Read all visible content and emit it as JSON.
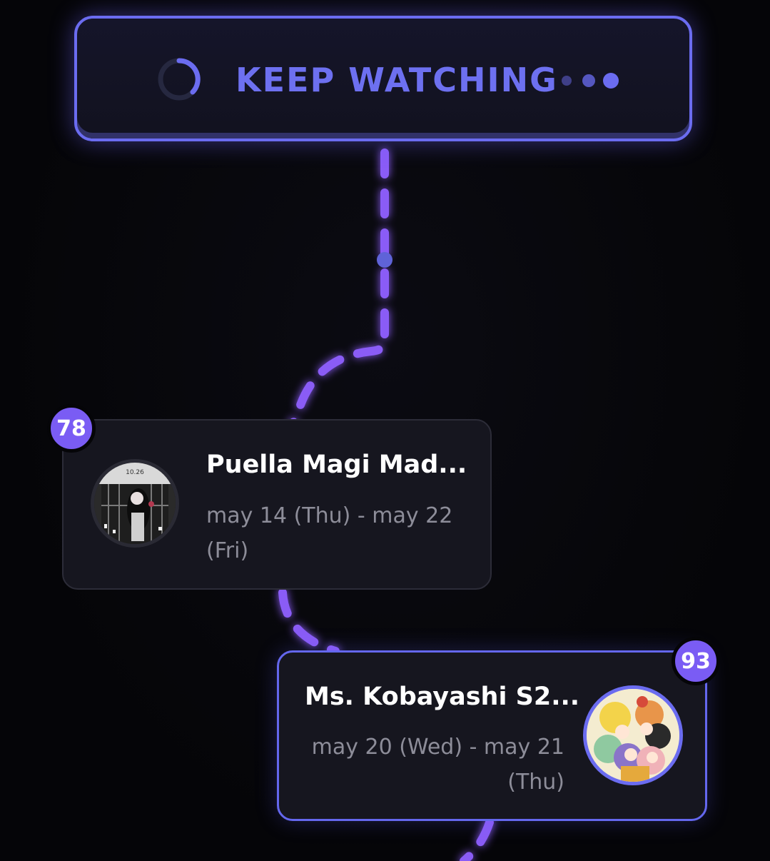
{
  "header": {
    "title": "KEEP WATCHING",
    "loading_icon": "spinner-icon",
    "more_icon": "more-dots-icon"
  },
  "items": [
    {
      "score": "78",
      "title": "Puella Magi Mad...",
      "dates": "may 14 (Thu) - may 22 (Fri)",
      "cover_icon": "anime-cover-image"
    },
    {
      "score": "93",
      "title": "Ms. Kobayashi S2...",
      "dates": "may 20 (Wed) - may 21 (Thu)",
      "cover_icon": "anime-cover-image"
    }
  ],
  "colors": {
    "accent": "#6b6cf0",
    "connector": "#8a5cf6",
    "badge": "#7a5cf4",
    "card_bg": "#16161f",
    "background": "#050508",
    "muted_text": "#8d8d99"
  }
}
